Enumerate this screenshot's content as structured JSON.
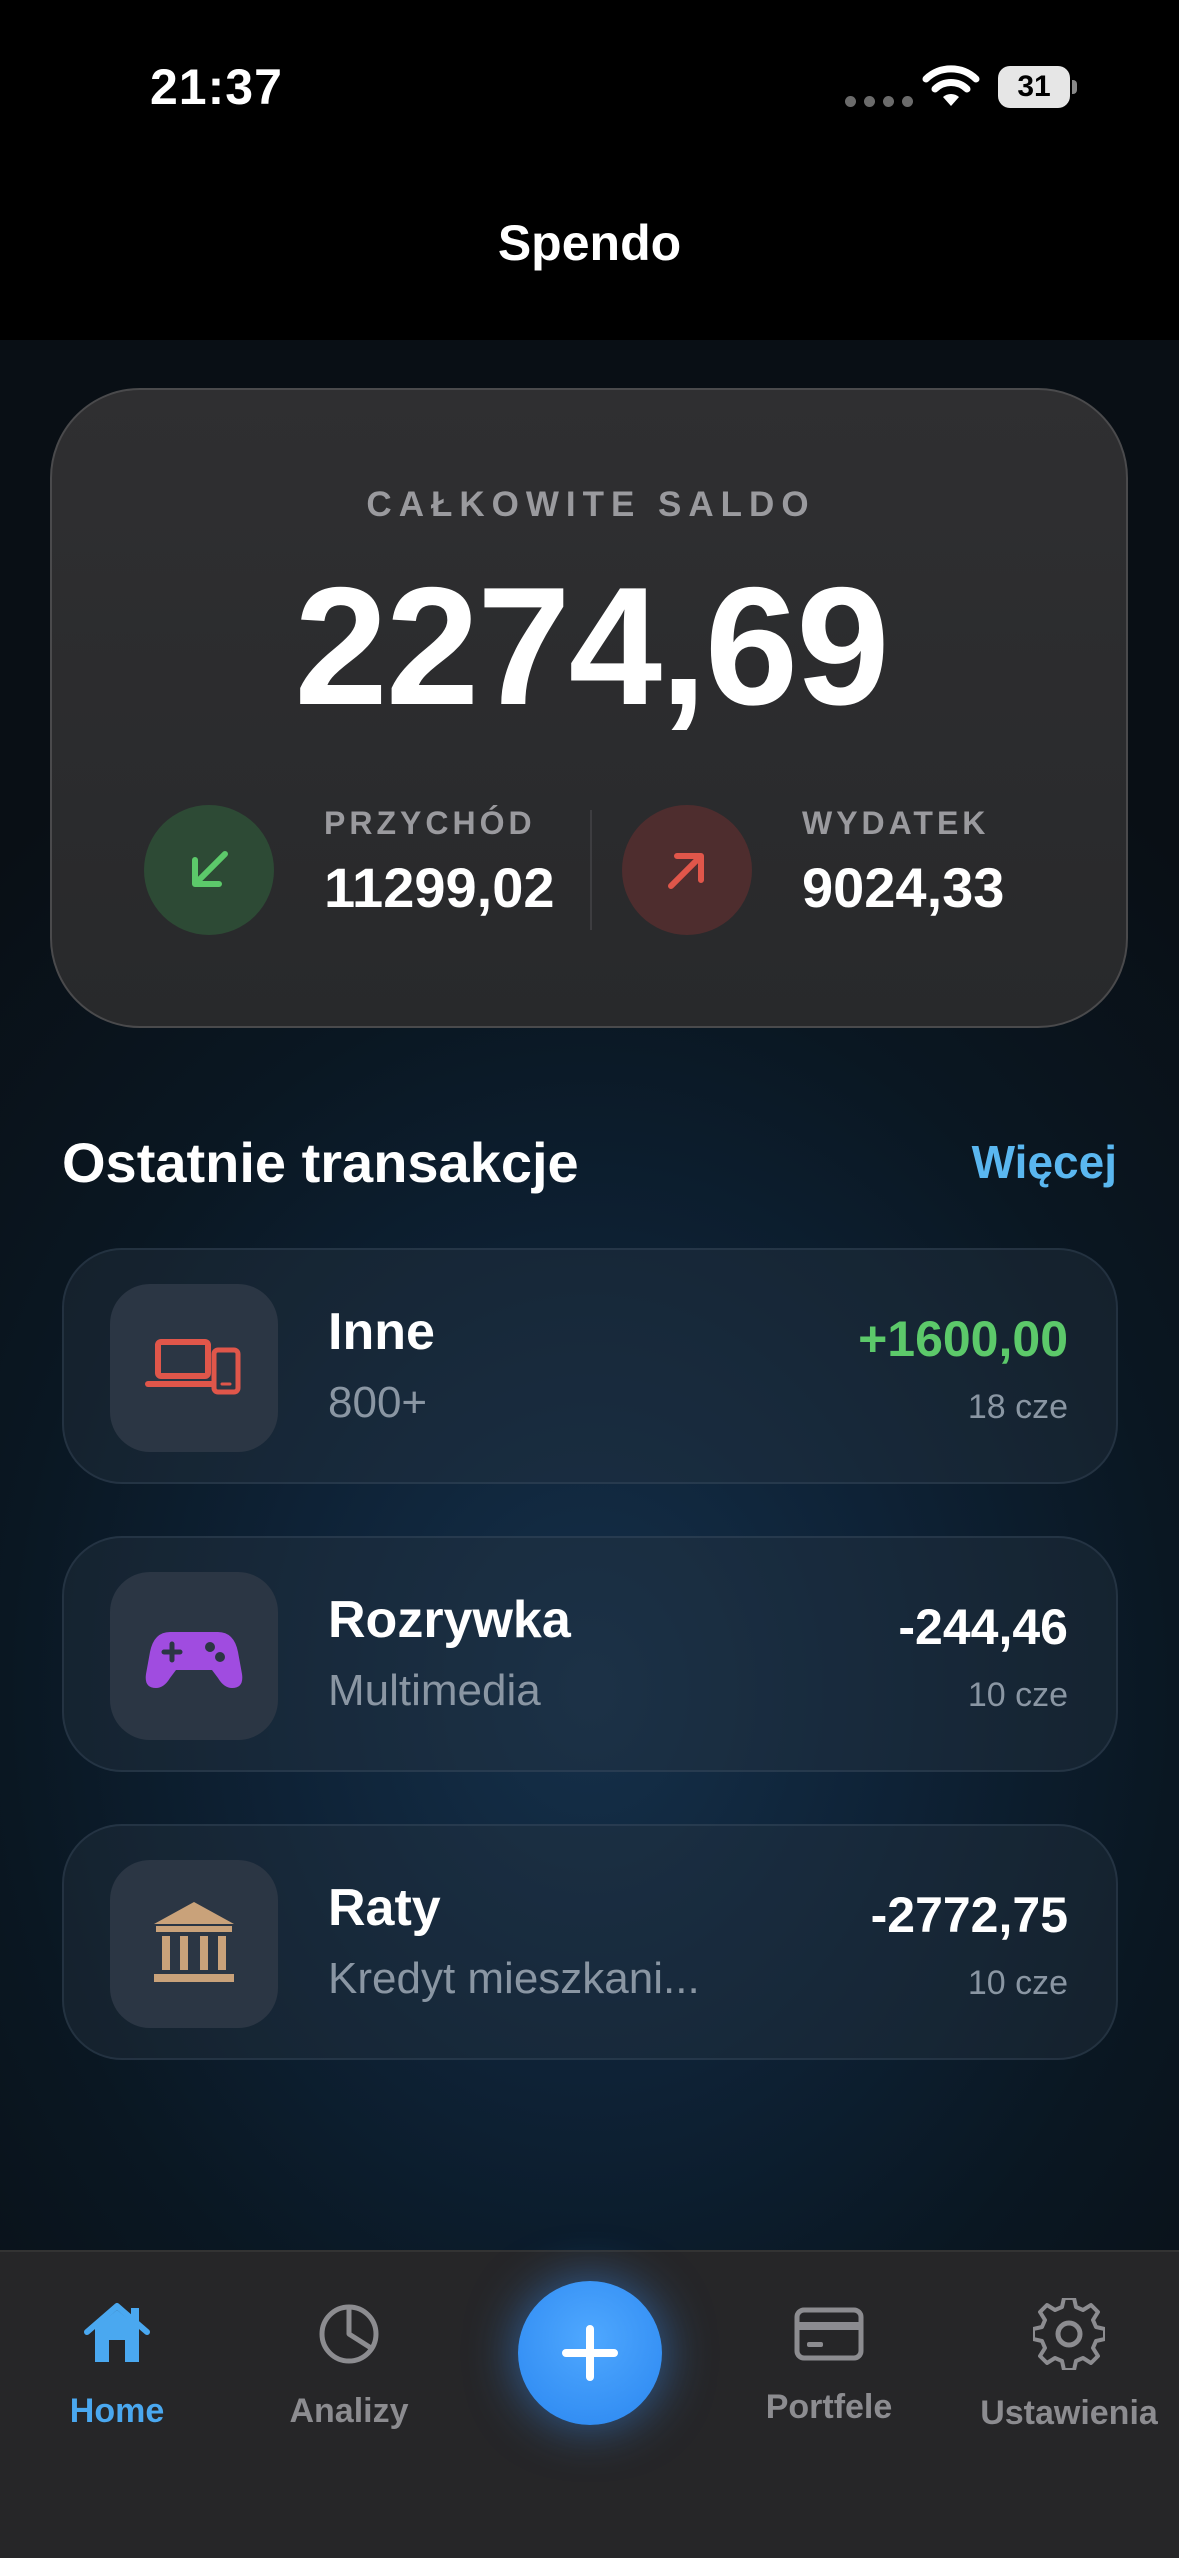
{
  "status_bar": {
    "time": "21:37",
    "battery": "31"
  },
  "app": {
    "title": "Spendo"
  },
  "balance": {
    "label": "CAŁKOWITE SALDO",
    "value": "2274,69",
    "income": {
      "label": "PRZYCHÓD",
      "value": "11299,02",
      "color": "#5cc96a"
    },
    "expense": {
      "label": "WYDATEK",
      "value": "9024,33",
      "color": "#e0564a"
    }
  },
  "recent": {
    "title": "Ostatnie transakcje",
    "more": "Więcej",
    "items": [
      {
        "name": "Inne",
        "sub": "800+",
        "amount": "+1600,00",
        "date": "18 cze",
        "icon": "devices-icon",
        "amount_color": "#5cc96a"
      },
      {
        "name": "Rozrywka",
        "sub": "Multimedia",
        "amount": "-244,46",
        "date": "10 cze",
        "icon": "gamepad-icon",
        "amount_color": "#ffffff"
      },
      {
        "name": "Raty",
        "sub": "Kredyt mieszkani...",
        "amount": "-2772,75",
        "date": "10 cze",
        "icon": "bank-icon",
        "amount_color": "#ffffff"
      }
    ]
  },
  "tabs": [
    {
      "label": "Home",
      "icon": "home-icon",
      "active": true
    },
    {
      "label": "Analizy",
      "icon": "pie-chart-icon",
      "active": false
    },
    {
      "label": "Portfele",
      "icon": "card-icon",
      "active": false
    },
    {
      "label": "Ustawienia",
      "icon": "gear-icon",
      "active": false
    }
  ],
  "colors": {
    "accent": "#4aa8f0",
    "link": "#5ab7f0",
    "background": "#0a1722"
  }
}
